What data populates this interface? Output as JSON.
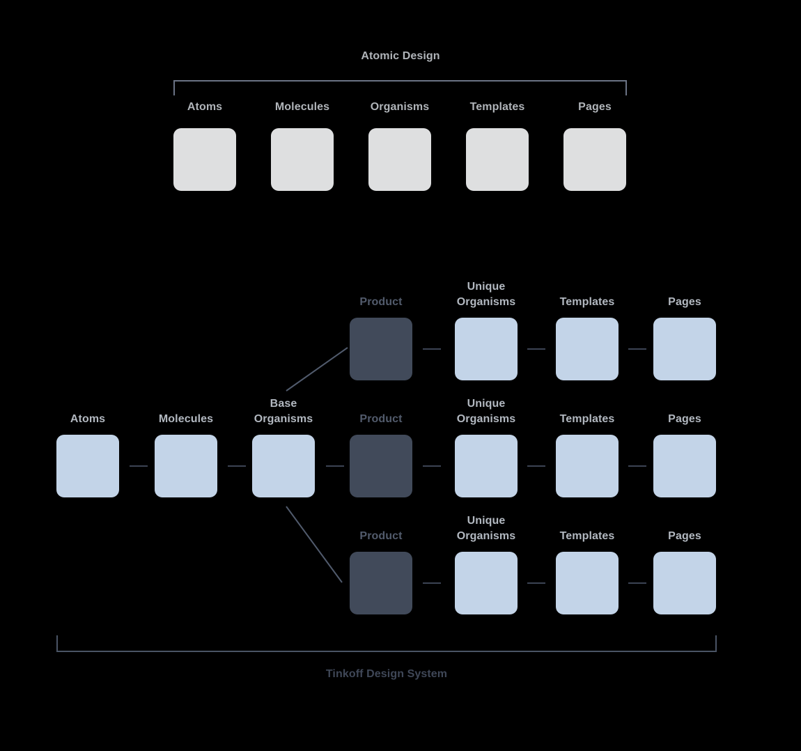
{
  "colors": {
    "background": "#000000",
    "gray_node": "#dedfe0",
    "blue_node": "#c3d4e8",
    "dark_node": "#414a5a",
    "gray_label": "#b0b4b9",
    "dark_label": "#525b6c",
    "connector": "#3c4454",
    "bracket_top": "#6b7385",
    "bracket_bottom": "#4a5465",
    "caption": "#3f4757"
  },
  "atomic_design": {
    "title": "Atomic Design",
    "stages": [
      {
        "label": "Atoms"
      },
      {
        "label": "Molecules"
      },
      {
        "label": "Organisms"
      },
      {
        "label": "Templates"
      },
      {
        "label": "Pages"
      }
    ]
  },
  "tinkoff": {
    "caption": "Tinkoff Design System",
    "shared": [
      {
        "label": "Atoms"
      },
      {
        "label": "Molecules"
      },
      {
        "label": "Base\nOrganisms"
      }
    ],
    "branches": [
      {
        "name": "top-branch",
        "stages": [
          {
            "label": "Product",
            "kind": "dark"
          },
          {
            "label": "Unique\nOrganisms",
            "kind": "blue"
          },
          {
            "label": "Templates",
            "kind": "blue"
          },
          {
            "label": "Pages",
            "kind": "blue"
          }
        ]
      },
      {
        "name": "middle-branch",
        "stages": [
          {
            "label": "Product",
            "kind": "dark"
          },
          {
            "label": "Unique\nOrganisms",
            "kind": "blue"
          },
          {
            "label": "Templates",
            "kind": "blue"
          },
          {
            "label": "Pages",
            "kind": "blue"
          }
        ]
      },
      {
        "name": "bottom-branch",
        "stages": [
          {
            "label": "Product",
            "kind": "dark"
          },
          {
            "label": "Unique\nOrganisms",
            "kind": "blue"
          },
          {
            "label": "Templates",
            "kind": "blue"
          },
          {
            "label": "Pages",
            "kind": "blue"
          }
        ]
      }
    ]
  }
}
